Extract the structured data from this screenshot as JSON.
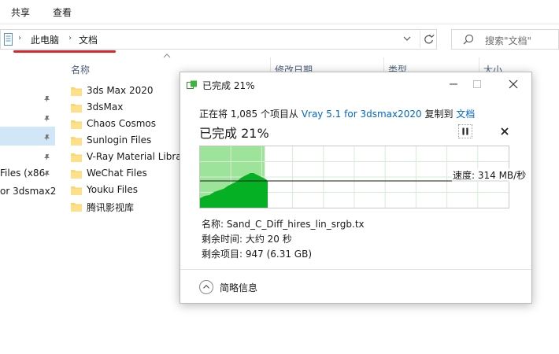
{
  "ribbon": {
    "tabs": [
      "共享",
      "查看"
    ]
  },
  "address": {
    "crumbs": [
      "此电脑",
      "文档"
    ]
  },
  "search": {
    "placeholder": "搜索\"文档\""
  },
  "nav": {
    "partial_items": [
      "Files (x86",
      "or 3dsmax2"
    ]
  },
  "columns": {
    "name": "名称",
    "modified": "修改日期",
    "type": "类型",
    "size": "大小"
  },
  "files": [
    "3ds Max 2020",
    "3dsMax",
    "Chaos Cosmos",
    "Sunlogin Files",
    "V-Ray Material Libra",
    "WeChat Files",
    "Youku Files",
    "腾讯影视库"
  ],
  "dialog": {
    "title": "已完成 21%",
    "line_prefix": "正在将 1,085 个项目从 ",
    "source": "Vray 5.1 for 3dsmax2020",
    "line_mid": " 复制到 ",
    "destination": "文档",
    "progress_text": "已完成 21%",
    "progress_percent": 21,
    "speed": "速度: 314 MB/秒",
    "name_line": "名称: Sand_C_Diff_hires_lin_srgb.tx",
    "time_line": "剩余时间: 大约 20 秒",
    "items_line": "剩余项目: 947 (6.31 GB)",
    "details_label": "简略信息"
  },
  "colors": {
    "accent_red": "#d9262b",
    "progress_fill": "#9ee39a",
    "graph_fill": "#06b025",
    "link": "#0066cc"
  }
}
